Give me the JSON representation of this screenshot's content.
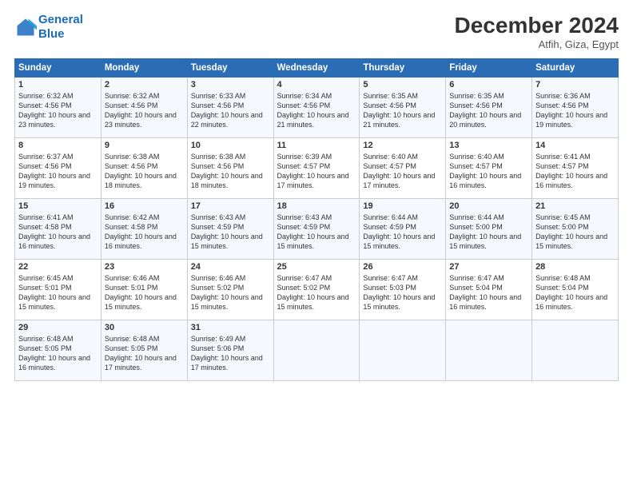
{
  "header": {
    "logo_line1": "General",
    "logo_line2": "Blue",
    "title": "December 2024",
    "location": "Atfih, Giza, Egypt"
  },
  "calendar": {
    "days_of_week": [
      "Sunday",
      "Monday",
      "Tuesday",
      "Wednesday",
      "Thursday",
      "Friday",
      "Saturday"
    ],
    "weeks": [
      [
        null,
        {
          "day": 2,
          "sunrise": "6:32 AM",
          "sunset": "4:56 PM",
          "daylight": "10 hours and 23 minutes."
        },
        {
          "day": 3,
          "sunrise": "6:33 AM",
          "sunset": "4:56 PM",
          "daylight": "10 hours and 22 minutes."
        },
        {
          "day": 4,
          "sunrise": "6:34 AM",
          "sunset": "4:56 PM",
          "daylight": "10 hours and 21 minutes."
        },
        {
          "day": 5,
          "sunrise": "6:35 AM",
          "sunset": "4:56 PM",
          "daylight": "10 hours and 21 minutes."
        },
        {
          "day": 6,
          "sunrise": "6:35 AM",
          "sunset": "4:56 PM",
          "daylight": "10 hours and 20 minutes."
        },
        {
          "day": 7,
          "sunrise": "6:36 AM",
          "sunset": "4:56 PM",
          "daylight": "10 hours and 19 minutes."
        }
      ],
      [
        {
          "day": 8,
          "sunrise": "6:37 AM",
          "sunset": "4:56 PM",
          "daylight": "10 hours and 19 minutes."
        },
        {
          "day": 9,
          "sunrise": "6:38 AM",
          "sunset": "4:56 PM",
          "daylight": "10 hours and 18 minutes."
        },
        {
          "day": 10,
          "sunrise": "6:38 AM",
          "sunset": "4:56 PM",
          "daylight": "10 hours and 18 minutes."
        },
        {
          "day": 11,
          "sunrise": "6:39 AM",
          "sunset": "4:57 PM",
          "daylight": "10 hours and 17 minutes."
        },
        {
          "day": 12,
          "sunrise": "6:40 AM",
          "sunset": "4:57 PM",
          "daylight": "10 hours and 17 minutes."
        },
        {
          "day": 13,
          "sunrise": "6:40 AM",
          "sunset": "4:57 PM",
          "daylight": "10 hours and 16 minutes."
        },
        {
          "day": 14,
          "sunrise": "6:41 AM",
          "sunset": "4:57 PM",
          "daylight": "10 hours and 16 minutes."
        }
      ],
      [
        {
          "day": 15,
          "sunrise": "6:41 AM",
          "sunset": "4:58 PM",
          "daylight": "10 hours and 16 minutes."
        },
        {
          "day": 16,
          "sunrise": "6:42 AM",
          "sunset": "4:58 PM",
          "daylight": "10 hours and 16 minutes."
        },
        {
          "day": 17,
          "sunrise": "6:43 AM",
          "sunset": "4:59 PM",
          "daylight": "10 hours and 15 minutes."
        },
        {
          "day": 18,
          "sunrise": "6:43 AM",
          "sunset": "4:59 PM",
          "daylight": "10 hours and 15 minutes."
        },
        {
          "day": 19,
          "sunrise": "6:44 AM",
          "sunset": "4:59 PM",
          "daylight": "10 hours and 15 minutes."
        },
        {
          "day": 20,
          "sunrise": "6:44 AM",
          "sunset": "5:00 PM",
          "daylight": "10 hours and 15 minutes."
        },
        {
          "day": 21,
          "sunrise": "6:45 AM",
          "sunset": "5:00 PM",
          "daylight": "10 hours and 15 minutes."
        }
      ],
      [
        {
          "day": 22,
          "sunrise": "6:45 AM",
          "sunset": "5:01 PM",
          "daylight": "10 hours and 15 minutes."
        },
        {
          "day": 23,
          "sunrise": "6:46 AM",
          "sunset": "5:01 PM",
          "daylight": "10 hours and 15 minutes."
        },
        {
          "day": 24,
          "sunrise": "6:46 AM",
          "sunset": "5:02 PM",
          "daylight": "10 hours and 15 minutes."
        },
        {
          "day": 25,
          "sunrise": "6:47 AM",
          "sunset": "5:02 PM",
          "daylight": "10 hours and 15 minutes."
        },
        {
          "day": 26,
          "sunrise": "6:47 AM",
          "sunset": "5:03 PM",
          "daylight": "10 hours and 15 minutes."
        },
        {
          "day": 27,
          "sunrise": "6:47 AM",
          "sunset": "5:04 PM",
          "daylight": "10 hours and 16 minutes."
        },
        {
          "day": 28,
          "sunrise": "6:48 AM",
          "sunset": "5:04 PM",
          "daylight": "10 hours and 16 minutes."
        }
      ],
      [
        {
          "day": 29,
          "sunrise": "6:48 AM",
          "sunset": "5:05 PM",
          "daylight": "10 hours and 16 minutes."
        },
        {
          "day": 30,
          "sunrise": "6:48 AM",
          "sunset": "5:05 PM",
          "daylight": "10 hours and 17 minutes."
        },
        {
          "day": 31,
          "sunrise": "6:49 AM",
          "sunset": "5:06 PM",
          "daylight": "10 hours and 17 minutes."
        },
        null,
        null,
        null,
        null
      ]
    ],
    "week1_day1": {
      "day": 1,
      "sunrise": "6:32 AM",
      "sunset": "4:56 PM",
      "daylight": "10 hours and 23 minutes."
    }
  }
}
